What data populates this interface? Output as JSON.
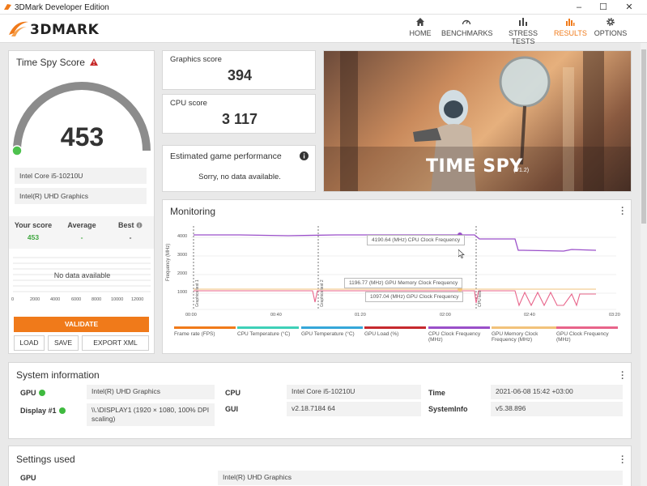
{
  "window": {
    "title": "3DMark Developer Edition",
    "controls": [
      "–",
      "☐",
      "✕"
    ]
  },
  "app": {
    "logo_text": "3DMARK"
  },
  "nav": [
    {
      "label": "HOME",
      "icon": "home-icon"
    },
    {
      "label": "BENCHMARKS",
      "icon": "gauge-icon"
    },
    {
      "label": "STRESS TESTS",
      "icon": "bars-icon"
    },
    {
      "label": "RESULTS",
      "icon": "results-icon",
      "active": true
    },
    {
      "label": "OPTIONS",
      "icon": "gear-icon"
    }
  ],
  "score": {
    "title": "Time Spy Score",
    "value": "453",
    "cpu_name": "Intel Core i5-10210U",
    "gpu_name": "Intel(R) UHD Graphics",
    "your_score_label": "Your score",
    "your_score_value": "453",
    "average_label": "Average",
    "average_value": "-",
    "best_label": "Best",
    "best_value": "-",
    "no_data": "No data available",
    "hist_ticks": [
      "0",
      "2000",
      "4000",
      "6000",
      "8000",
      "10000",
      "12000"
    ],
    "validate_label": "VALIDATE",
    "load_label": "LOAD",
    "save_label": "SAVE",
    "export_label": "EXPORT XML"
  },
  "graphics": {
    "label": "Graphics score",
    "value": "394"
  },
  "cpu": {
    "label": "CPU score",
    "value": "3 117"
  },
  "game": {
    "label": "Estimated game performance",
    "message": "Sorry, no data available."
  },
  "banner": {
    "title": "TIME SPY",
    "version": "(V1.2)"
  },
  "monitoring": {
    "title": "Monitoring",
    "y_axis_label": "Frequency (MHz)",
    "y_ticks": [
      "4000",
      "3000",
      "2000",
      "1000"
    ],
    "x_ticks": [
      "00:00",
      "00:40",
      "01:20",
      "02:00",
      "02:40",
      "03:20"
    ],
    "markers": [
      "Graphics test 1",
      "Graphics test 2",
      "CPU test"
    ],
    "tooltips": {
      "cpu_clock": "4190.64 (MHz) CPU Clock Frequency",
      "gpu_mem_clock": "1196.77 (MHz) GPU Memory Clock Frequency",
      "gpu_clock": "1097.04 (MHz) GPU Clock Frequency"
    },
    "legend": [
      {
        "label": "Frame rate (FPS)",
        "color": "#f07a1a"
      },
      {
        "label": "CPU Temperature (°C)",
        "color": "#3fd0b8"
      },
      {
        "label": "GPU Temperature (°C)",
        "color": "#35a7d9"
      },
      {
        "label": "GPU Load (%)",
        "color": "#c6292e"
      },
      {
        "label": "CPU Clock Frequency (MHz)",
        "color": "#9a4fc9"
      },
      {
        "label": "GPU Memory Clock Frequency (MHz)",
        "color": "#f2c27a"
      },
      {
        "label": "GPU Clock Frequency (MHz)",
        "color": "#e8648a"
      }
    ]
  },
  "system": {
    "title": "System information",
    "gpu_label": "GPU",
    "gpu_value": "Intel(R) UHD Graphics",
    "display_label": "Display #1",
    "display_value": "\\\\.\\DISPLAY1 (1920 × 1080, 100% DPI scaling)",
    "cpu_label": "CPU",
    "cpu_value": "Intel Core i5-10210U",
    "gui_label": "GUI",
    "gui_value": "v2.18.7184 64",
    "time_label": "Time",
    "time_value": "2021-06-08 15:42 +03:00",
    "sysinfo_label": "SystemInfo",
    "sysinfo_value": "v5.38.896"
  },
  "settings": {
    "title": "Settings used",
    "gpu_label": "GPU",
    "gpu_value": "Intel(R) UHD Graphics"
  }
}
